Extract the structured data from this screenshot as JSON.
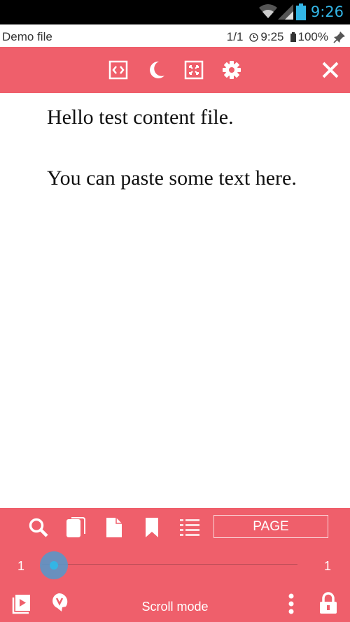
{
  "status_bar": {
    "time": "9:26",
    "icons": [
      "wifi-icon",
      "signal-icon",
      "battery-icon"
    ],
    "accent": "#33b5e5"
  },
  "info_bar": {
    "title": "Demo file",
    "page": "1/1",
    "clock": "9:25",
    "battery": "100%",
    "icons": [
      "clock-icon",
      "battery-small-icon",
      "pin-icon"
    ]
  },
  "toolbar": {
    "color": "#ef5f6b",
    "icons": [
      "fit-width-icon",
      "night-mode-icon",
      "fullscreen-icon",
      "settings-icon",
      "close-icon"
    ]
  },
  "content": {
    "paragraphs": [
      "Hello test content file.",
      "You can paste some text here."
    ]
  },
  "bottom_bar": {
    "icons": [
      "search-icon",
      "copy-icon",
      "document-icon",
      "bookmark-icon",
      "list-icon"
    ],
    "page_button": "PAGE",
    "slider": {
      "min_label": "1",
      "max_label": "1",
      "value": 1
    },
    "mode_label": "Scroll mode",
    "bottom_icons": [
      "play-icon",
      "tts-icon",
      "more-icon",
      "lock-icon"
    ]
  }
}
